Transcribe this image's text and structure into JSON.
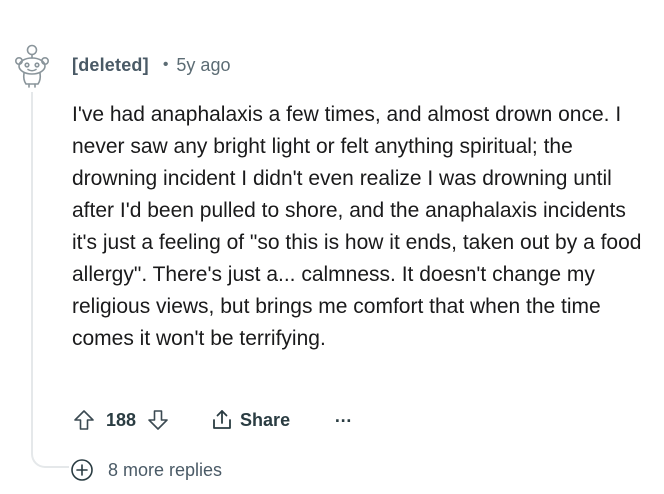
{
  "comment": {
    "author": "[deleted]",
    "separator": "•",
    "timestamp": "5y ago",
    "body": "I've had anaphalaxis a few times, and almost drown once. I never saw any bright light or felt anything spiritual; the drowning incident I didn't even realize I was drowning until after I'd been pulled to shore, and the anaphalaxis incidents it's just a feeling of \"so this is how it ends, taken out by a food allergy\". There's just a... calmness. It doesn't change my religious views, but brings me comfort that when the time comes it won't be terrifying.",
    "avatar_icon": "reddit-snoo-icon"
  },
  "actions": {
    "score": "188",
    "upvote_icon": "upvote-arrow-icon",
    "downvote_icon": "downvote-arrow-icon",
    "share_label": "Share",
    "share_icon": "share-icon",
    "more_label": "…",
    "more_icon": "more-options-icon"
  },
  "replies": {
    "label": "8 more replies",
    "icon": "plus-circle-icon"
  },
  "colors": {
    "text": "#1a1a1b",
    "meta": "#5c6c74",
    "thread_line": "#e5e8ea",
    "icon": "#5c6c74"
  }
}
